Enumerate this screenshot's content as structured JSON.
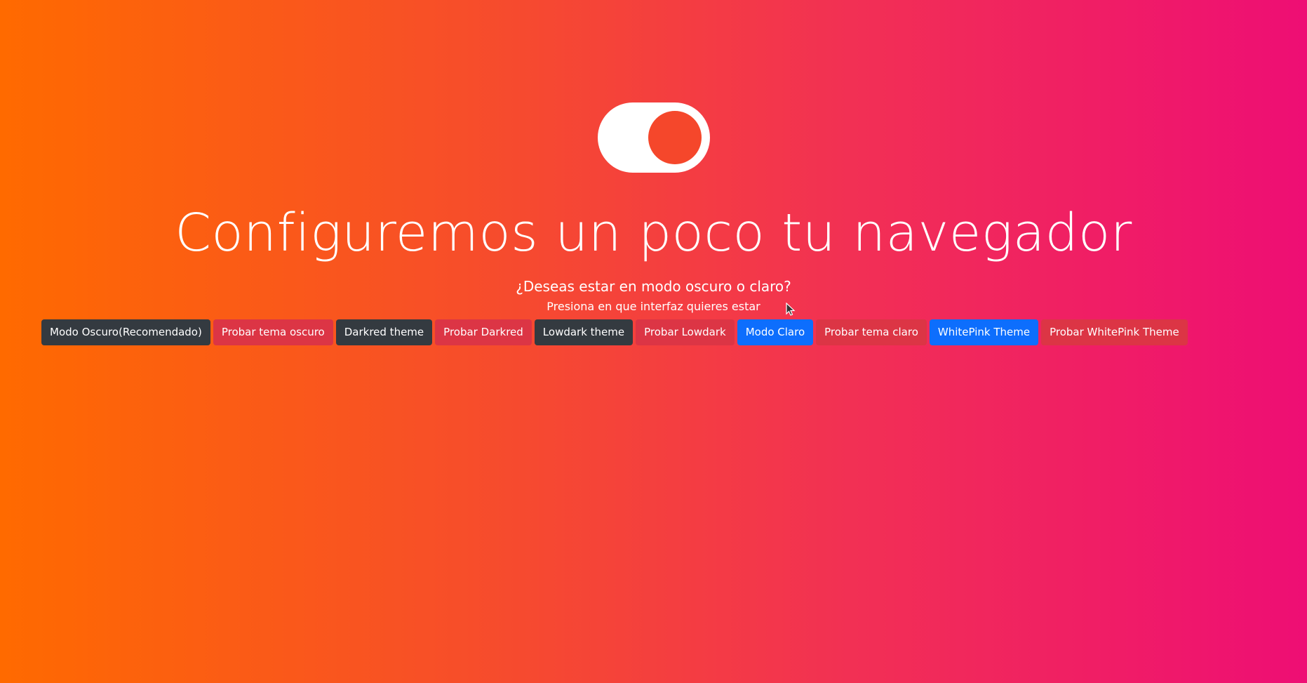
{
  "page": {
    "title": "Configuremos un poco tu navegador",
    "subtitle": "¿Deseas estar en modo oscuro o claro?",
    "hint": "Presiona en que interfaz quieres estar"
  },
  "toggle": {
    "state": "on"
  },
  "buttons": [
    {
      "label": "Modo Oscuro(Recomendado)",
      "style": "dark",
      "color": "#343a40"
    },
    {
      "label": "Probar tema oscuro",
      "style": "red",
      "color": "#dc3545"
    },
    {
      "label": "Darkred theme",
      "style": "dark",
      "color": "#343a40"
    },
    {
      "label": "Probar Darkred",
      "style": "red",
      "color": "#dc3545"
    },
    {
      "label": "Lowdark theme",
      "style": "dark",
      "color": "#343a40"
    },
    {
      "label": "Probar Lowdark",
      "style": "red",
      "color": "#dc3545"
    },
    {
      "label": "Modo Claro",
      "style": "blue",
      "color": "#0d6efd"
    },
    {
      "label": "Probar tema claro",
      "style": "red",
      "color": "#dc3545"
    },
    {
      "label": "WhitePink Theme",
      "style": "blue",
      "color": "#0d6efd"
    },
    {
      "label": "Probar WhitePink Theme",
      "style": "red",
      "color": "#dc3545"
    }
  ],
  "colors": {
    "gradient_start": "#ff6a00",
    "gradient_end": "#ee0e74",
    "text": "#ffffff"
  }
}
